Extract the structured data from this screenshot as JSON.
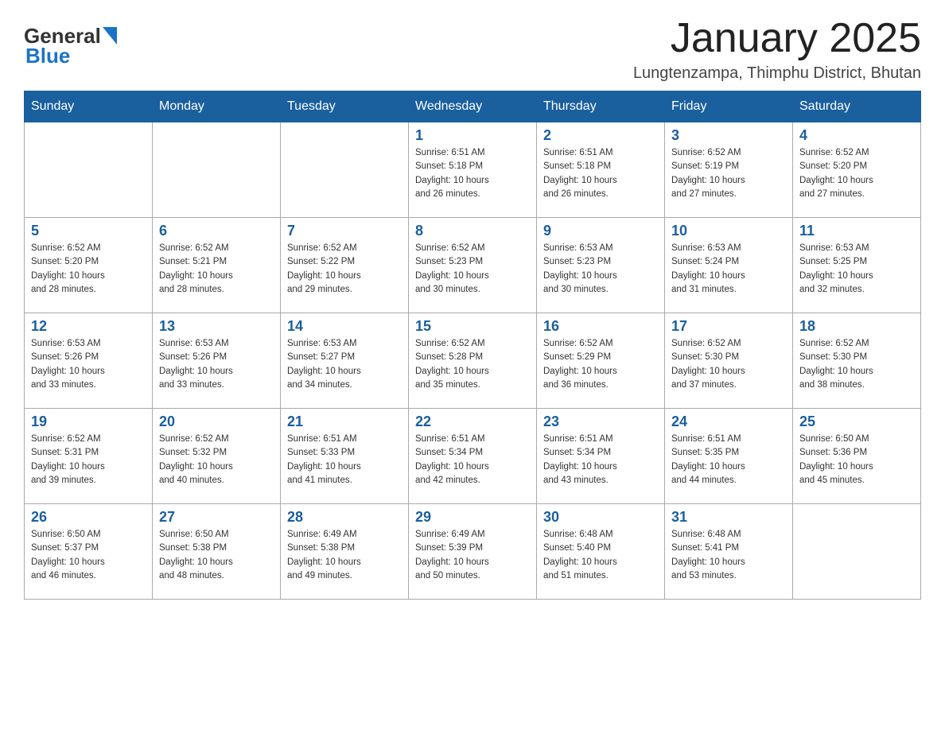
{
  "logo": {
    "text_general": "General",
    "text_blue": "Blue"
  },
  "header": {
    "month": "January 2025",
    "location": "Lungtenzampa, Thimphu District, Bhutan"
  },
  "weekdays": [
    "Sunday",
    "Monday",
    "Tuesday",
    "Wednesday",
    "Thursday",
    "Friday",
    "Saturday"
  ],
  "weeks": [
    [
      {
        "day": "",
        "info": ""
      },
      {
        "day": "",
        "info": ""
      },
      {
        "day": "",
        "info": ""
      },
      {
        "day": "1",
        "info": "Sunrise: 6:51 AM\nSunset: 5:18 PM\nDaylight: 10 hours\nand 26 minutes."
      },
      {
        "day": "2",
        "info": "Sunrise: 6:51 AM\nSunset: 5:18 PM\nDaylight: 10 hours\nand 26 minutes."
      },
      {
        "day": "3",
        "info": "Sunrise: 6:52 AM\nSunset: 5:19 PM\nDaylight: 10 hours\nand 27 minutes."
      },
      {
        "day": "4",
        "info": "Sunrise: 6:52 AM\nSunset: 5:20 PM\nDaylight: 10 hours\nand 27 minutes."
      }
    ],
    [
      {
        "day": "5",
        "info": "Sunrise: 6:52 AM\nSunset: 5:20 PM\nDaylight: 10 hours\nand 28 minutes."
      },
      {
        "day": "6",
        "info": "Sunrise: 6:52 AM\nSunset: 5:21 PM\nDaylight: 10 hours\nand 28 minutes."
      },
      {
        "day": "7",
        "info": "Sunrise: 6:52 AM\nSunset: 5:22 PM\nDaylight: 10 hours\nand 29 minutes."
      },
      {
        "day": "8",
        "info": "Sunrise: 6:52 AM\nSunset: 5:23 PM\nDaylight: 10 hours\nand 30 minutes."
      },
      {
        "day": "9",
        "info": "Sunrise: 6:53 AM\nSunset: 5:23 PM\nDaylight: 10 hours\nand 30 minutes."
      },
      {
        "day": "10",
        "info": "Sunrise: 6:53 AM\nSunset: 5:24 PM\nDaylight: 10 hours\nand 31 minutes."
      },
      {
        "day": "11",
        "info": "Sunrise: 6:53 AM\nSunset: 5:25 PM\nDaylight: 10 hours\nand 32 minutes."
      }
    ],
    [
      {
        "day": "12",
        "info": "Sunrise: 6:53 AM\nSunset: 5:26 PM\nDaylight: 10 hours\nand 33 minutes."
      },
      {
        "day": "13",
        "info": "Sunrise: 6:53 AM\nSunset: 5:26 PM\nDaylight: 10 hours\nand 33 minutes."
      },
      {
        "day": "14",
        "info": "Sunrise: 6:53 AM\nSunset: 5:27 PM\nDaylight: 10 hours\nand 34 minutes."
      },
      {
        "day": "15",
        "info": "Sunrise: 6:52 AM\nSunset: 5:28 PM\nDaylight: 10 hours\nand 35 minutes."
      },
      {
        "day": "16",
        "info": "Sunrise: 6:52 AM\nSunset: 5:29 PM\nDaylight: 10 hours\nand 36 minutes."
      },
      {
        "day": "17",
        "info": "Sunrise: 6:52 AM\nSunset: 5:30 PM\nDaylight: 10 hours\nand 37 minutes."
      },
      {
        "day": "18",
        "info": "Sunrise: 6:52 AM\nSunset: 5:30 PM\nDaylight: 10 hours\nand 38 minutes."
      }
    ],
    [
      {
        "day": "19",
        "info": "Sunrise: 6:52 AM\nSunset: 5:31 PM\nDaylight: 10 hours\nand 39 minutes."
      },
      {
        "day": "20",
        "info": "Sunrise: 6:52 AM\nSunset: 5:32 PM\nDaylight: 10 hours\nand 40 minutes."
      },
      {
        "day": "21",
        "info": "Sunrise: 6:51 AM\nSunset: 5:33 PM\nDaylight: 10 hours\nand 41 minutes."
      },
      {
        "day": "22",
        "info": "Sunrise: 6:51 AM\nSunset: 5:34 PM\nDaylight: 10 hours\nand 42 minutes."
      },
      {
        "day": "23",
        "info": "Sunrise: 6:51 AM\nSunset: 5:34 PM\nDaylight: 10 hours\nand 43 minutes."
      },
      {
        "day": "24",
        "info": "Sunrise: 6:51 AM\nSunset: 5:35 PM\nDaylight: 10 hours\nand 44 minutes."
      },
      {
        "day": "25",
        "info": "Sunrise: 6:50 AM\nSunset: 5:36 PM\nDaylight: 10 hours\nand 45 minutes."
      }
    ],
    [
      {
        "day": "26",
        "info": "Sunrise: 6:50 AM\nSunset: 5:37 PM\nDaylight: 10 hours\nand 46 minutes."
      },
      {
        "day": "27",
        "info": "Sunrise: 6:50 AM\nSunset: 5:38 PM\nDaylight: 10 hours\nand 48 minutes."
      },
      {
        "day": "28",
        "info": "Sunrise: 6:49 AM\nSunset: 5:38 PM\nDaylight: 10 hours\nand 49 minutes."
      },
      {
        "day": "29",
        "info": "Sunrise: 6:49 AM\nSunset: 5:39 PM\nDaylight: 10 hours\nand 50 minutes."
      },
      {
        "day": "30",
        "info": "Sunrise: 6:48 AM\nSunset: 5:40 PM\nDaylight: 10 hours\nand 51 minutes."
      },
      {
        "day": "31",
        "info": "Sunrise: 6:48 AM\nSunset: 5:41 PM\nDaylight: 10 hours\nand 53 minutes."
      },
      {
        "day": "",
        "info": ""
      }
    ]
  ]
}
